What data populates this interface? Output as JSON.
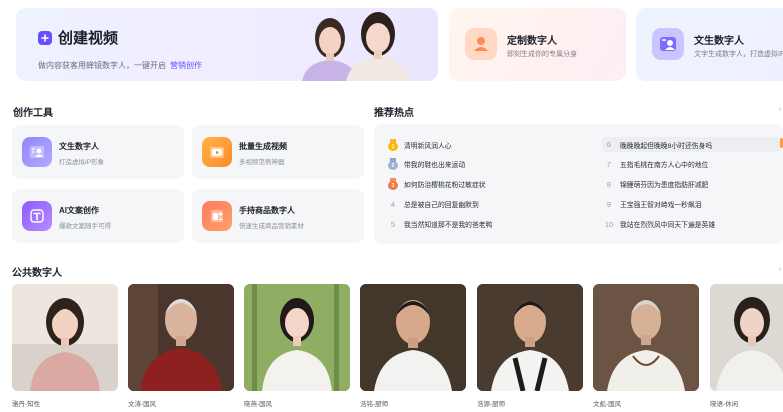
{
  "banners": {
    "create": {
      "title": "创建视频",
      "subtitle": "做内容获客用蝉镜数字人，一键开启",
      "link": "营销创作"
    },
    "custom": {
      "title": "定制数字人",
      "subtitle": "即刻生成你的专属分身"
    },
    "text": {
      "title": "文生数字人",
      "subtitle": "文字生成数字人，打造虚拟IP"
    }
  },
  "sections": {
    "tools": "创作工具",
    "hot": "推荐热点",
    "public": "公共数字人"
  },
  "tools": [
    {
      "name": "文生数字人",
      "desc": "打造虚拟IP形象",
      "icon": "text-avatar-icon"
    },
    {
      "name": "批量生成视频",
      "desc": "多视频范例神器",
      "icon": "batch-video-icon"
    },
    {
      "name": "AI文案创作",
      "desc": "爆款文案随手可得",
      "icon": "ai-copy-icon"
    },
    {
      "name": "手持商品数字人",
      "desc": "快速生成商品营销素材",
      "icon": "product-avatar-icon"
    }
  ],
  "hot": [
    {
      "rank": "1",
      "text": "清明新风润人心"
    },
    {
      "rank": "2",
      "text": "带我的鞋也出来运动"
    },
    {
      "rank": "3",
      "text": "如何防治樱桃花粉过敏症状"
    },
    {
      "rank": "4",
      "text": "总是被自己的回复幽默到"
    },
    {
      "rank": "5",
      "text": "我当然知道那不是我的爸老鸭"
    },
    {
      "rank": "6",
      "text": "晚晚晚起但晚晚8小时还伤身吗"
    },
    {
      "rank": "7",
      "text": "五指毛桃在南方人心中的地位"
    },
    {
      "rank": "8",
      "text": "锦鲤萌芬因为患度指肪肝减肥"
    },
    {
      "rank": "9",
      "text": "王宝强王智对峙戏一秒飙泪"
    },
    {
      "rank": "10",
      "text": "我站在烈烈风中同天下遍是英雄"
    }
  ],
  "avatars": [
    {
      "name": "骆丹-知性"
    },
    {
      "name": "文涛-国风"
    },
    {
      "name": "晓燕-国风"
    },
    {
      "name": "浩铭-厨师"
    },
    {
      "name": "浩源-厨师"
    },
    {
      "name": "文彪-国风"
    },
    {
      "name": "晓语-休闲"
    }
  ],
  "colors": {
    "accent": "#5b53ff",
    "panel": "#f5f6f8",
    "hot_orange": "#ff9c3f"
  }
}
